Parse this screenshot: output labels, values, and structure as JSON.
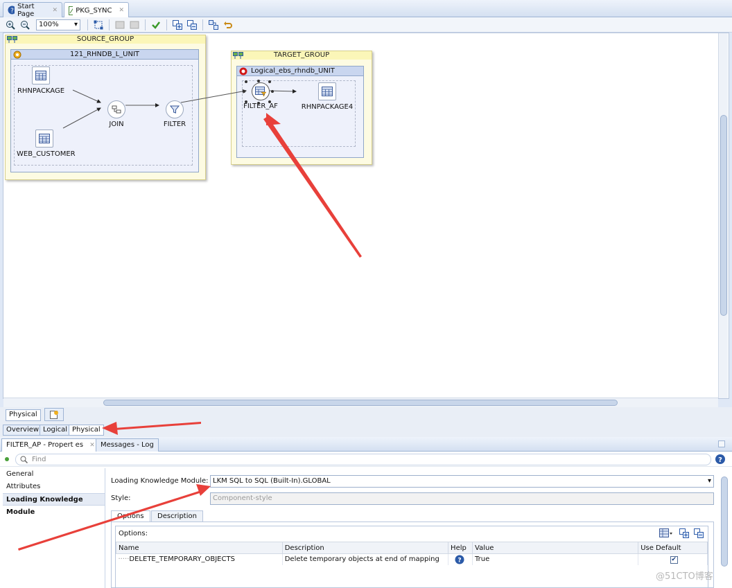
{
  "editor_tabs": [
    {
      "label": "Start Page",
      "icon": "help-icon"
    },
    {
      "label": "PKG_SYNC",
      "icon": "mapping-icon"
    }
  ],
  "toolbar": {
    "zoom": "100%"
  },
  "canvas": {
    "source_group": {
      "title": "SOURCE_GROUP",
      "unit_title": "121_RHNDB_L_UNIT",
      "nodes": {
        "rhnpackage": "RHNPACKAGE",
        "web_customer": "WEB_CUSTOMER",
        "join": "JOIN",
        "filter": "FILTER"
      }
    },
    "target_group": {
      "title": "TARGET_GROUP",
      "unit_title": "Logical_ebs_rhndb_UNIT",
      "nodes": {
        "filter_ap": "FILTER_AF",
        "rhnpackage4": "RHNPACKAGE4"
      }
    }
  },
  "diagram_tabs": {
    "physical": "Physical"
  },
  "view_tabs": [
    "Overview",
    "Logical",
    "Physical"
  ],
  "bottom_tabs": [
    {
      "label": "FILTER_AP - Propert es"
    },
    {
      "label": "Messages - Log"
    }
  ],
  "find": {
    "placeholder": "Find"
  },
  "nav": [
    "General",
    "Attributes",
    "Loading Knowledge Module"
  ],
  "form": {
    "lkm_label": "Loading Knowledge Module:",
    "lkm_value": "LKM SQL to SQL (Built-In).GLOBAL",
    "style_label": "Style:",
    "style_value": "Component-style"
  },
  "sub_tabs": [
    "Options",
    "Description"
  ],
  "options": {
    "label": "Options:",
    "columns": [
      "Name",
      "Description",
      "Help",
      "Value",
      "Use Default"
    ],
    "rows": [
      {
        "name": "DELETE_TEMPORARY_OBJECTS",
        "description": "Delete temporary objects at end of mapping",
        "value": "True",
        "use_default": true
      }
    ]
  },
  "watermark": "@51CTO博客",
  "colors": {
    "accent": "#2b5aa8",
    "annotation_arrow": "#e8403a"
  }
}
